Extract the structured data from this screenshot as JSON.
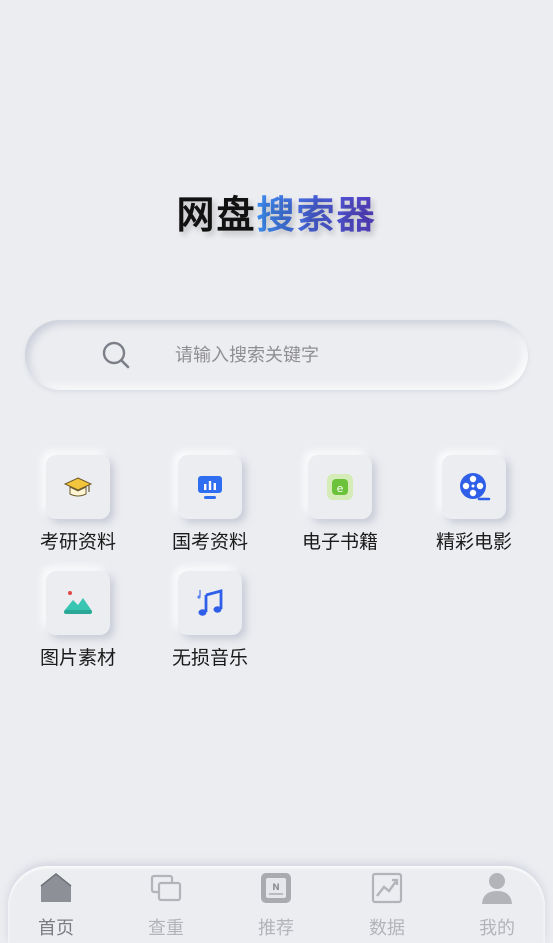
{
  "app_title": {
    "part1": "网盘",
    "part2": "搜索器"
  },
  "search": {
    "placeholder": "请输入搜索关键字"
  },
  "categories": [
    {
      "label": "考研资料",
      "icon": "graduation-cap-icon"
    },
    {
      "label": "国考资料",
      "icon": "presentation-board-icon"
    },
    {
      "label": "电子书籍",
      "icon": "ebook-icon"
    },
    {
      "label": "精彩电影",
      "icon": "film-reel-icon"
    },
    {
      "label": "图片素材",
      "icon": "landscape-image-icon"
    },
    {
      "label": "无损音乐",
      "icon": "music-note-icon"
    }
  ],
  "tabbar": [
    {
      "label": "首页",
      "icon": "home-icon",
      "active": true
    },
    {
      "label": "查重",
      "icon": "duplicate-check-icon",
      "active": false
    },
    {
      "label": "推荐",
      "icon": "recommend-news-icon",
      "active": false
    },
    {
      "label": "数据",
      "icon": "trend-chart-icon",
      "active": false
    },
    {
      "label": "我的",
      "icon": "user-profile-icon",
      "active": false
    }
  ],
  "colors": {
    "background": "#ecedf1",
    "accent_blue": "#3b6cf0",
    "tab_inactive": "#b2b4ba"
  }
}
